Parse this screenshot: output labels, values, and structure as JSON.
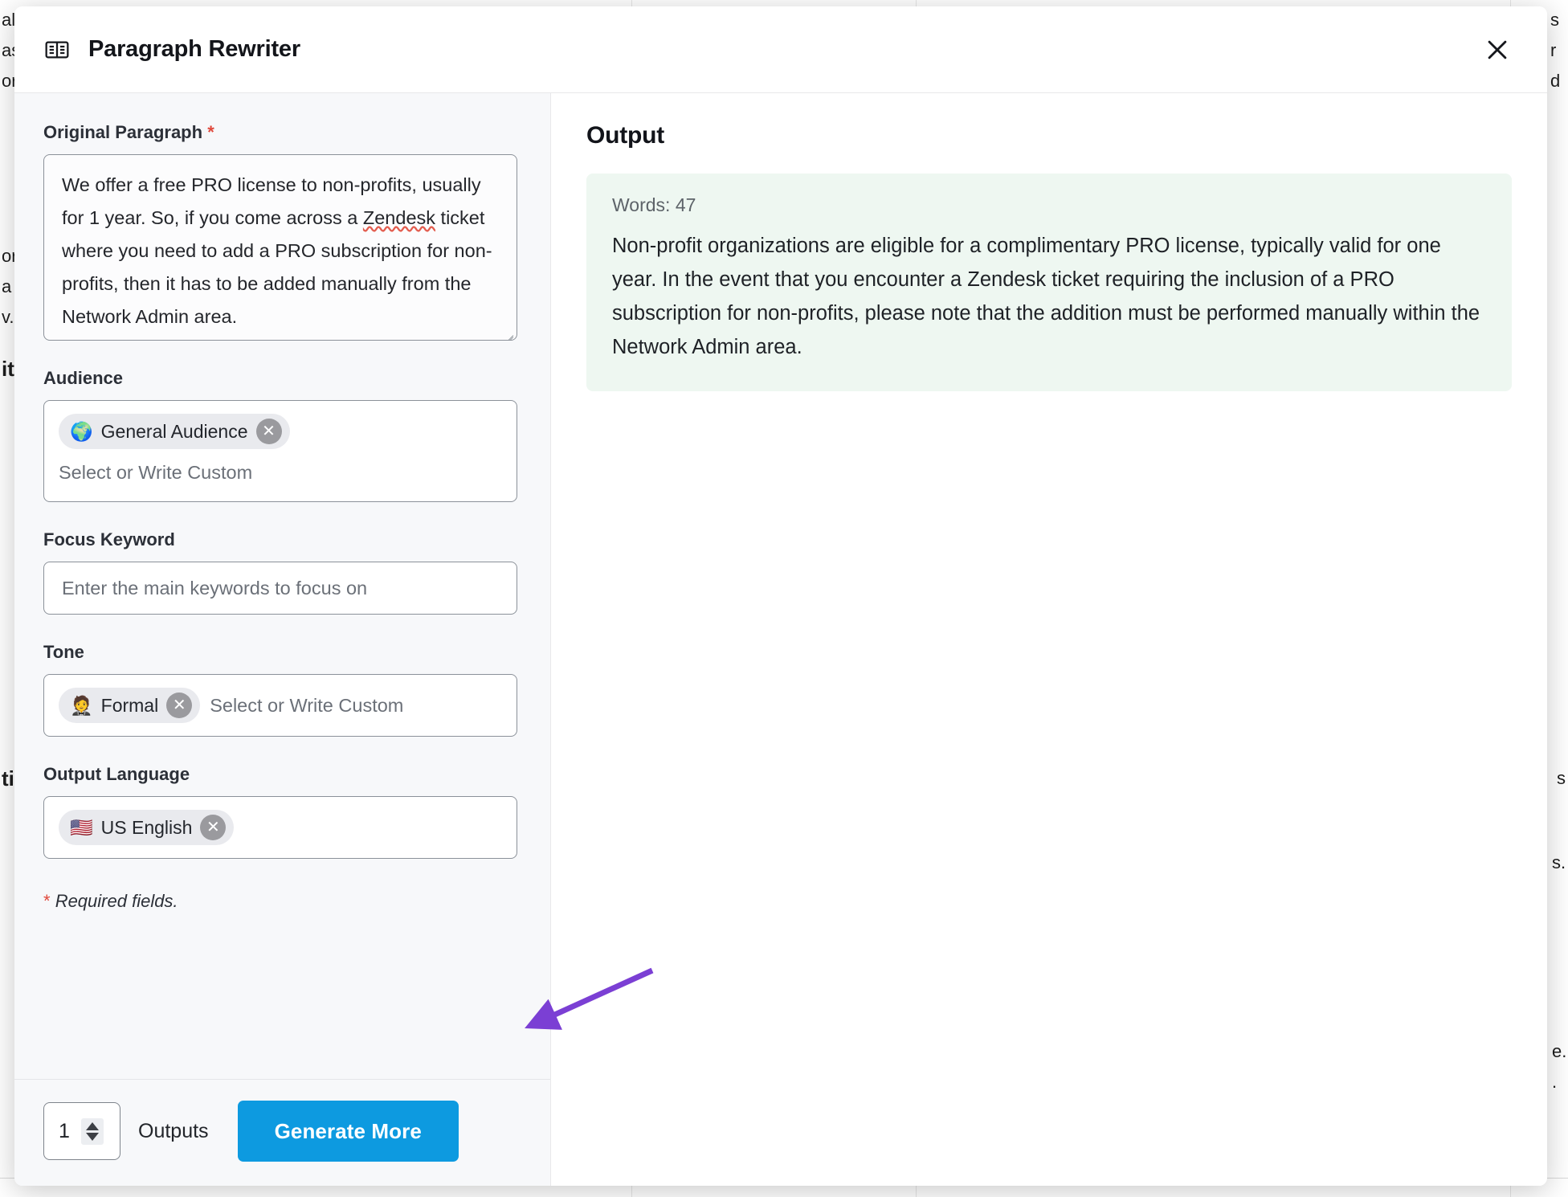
{
  "header": {
    "title": "Paragraph Rewriter",
    "icon": "article-book-icon",
    "close_icon": "close-icon"
  },
  "form": {
    "original_paragraph": {
      "label": "Original Paragraph",
      "required_marker": "*",
      "value_part1": "We offer a free PRO license to non-profits, usually for 1 year. So, if you come across a ",
      "value_misspelled": "Zendesk",
      "value_part2": " ticket where you need to add a PRO subscription for non-profits, then it has to be added manually from the Network Admin area.",
      "full_value": "We offer a free PRO license to non-profits, usually for 1 year. So, if you come across a Zendesk ticket where you need to add a PRO subscription for non-profits, then it has to be added manually from the Network Admin area."
    },
    "audience": {
      "label": "Audience",
      "tags": [
        {
          "emoji": "🌍",
          "label": "General Audience",
          "remove_icon": "remove-tag-icon"
        }
      ],
      "placeholder": "Select or Write Custom"
    },
    "focus_keyword": {
      "label": "Focus Keyword",
      "placeholder": "Enter the main keywords to focus on",
      "value": ""
    },
    "tone": {
      "label": "Tone",
      "tags": [
        {
          "emoji": "🤵",
          "label": "Formal",
          "remove_icon": "remove-tag-icon"
        }
      ],
      "placeholder": "Select or Write Custom"
    },
    "output_language": {
      "label": "Output Language",
      "tags": [
        {
          "emoji": "🇺🇸",
          "label": "US English",
          "remove_icon": "remove-tag-icon"
        }
      ]
    },
    "required_note_star": "*",
    "required_note": "Required fields."
  },
  "footer": {
    "outputs_count": "1",
    "outputs_label": "Outputs",
    "generate_button": "Generate More",
    "spinner_up_icon": "spinner-up-icon",
    "spinner_down_icon": "spinner-down-icon"
  },
  "output": {
    "title": "Output",
    "words_label": "Words: 47",
    "text": "Non-profit organizations are eligible for a complimentary PRO license, typically valid for one year. In the event that you encounter a Zendesk ticket requiring the inclusion of a PRO subscription for non-profits, please note that the addition must be performed manually within the Network Admin area."
  },
  "background": {
    "fragments": [
      "al\nas\nor",
      "s\nr\nd",
      "or\na\nv.",
      "it",
      "ti",
      "s",
      "s.",
      "e.\n.",
      "."
    ]
  },
  "colors": {
    "accent_blue": "#0d9ae0",
    "output_card_bg": "#eef7f1",
    "form_bg": "#f7f8fa",
    "required_red": "#e0483b",
    "annotation_purple": "#7b3fd4",
    "tag_bg": "#e9eaee",
    "tag_remove_bg": "#9a9a9e"
  }
}
